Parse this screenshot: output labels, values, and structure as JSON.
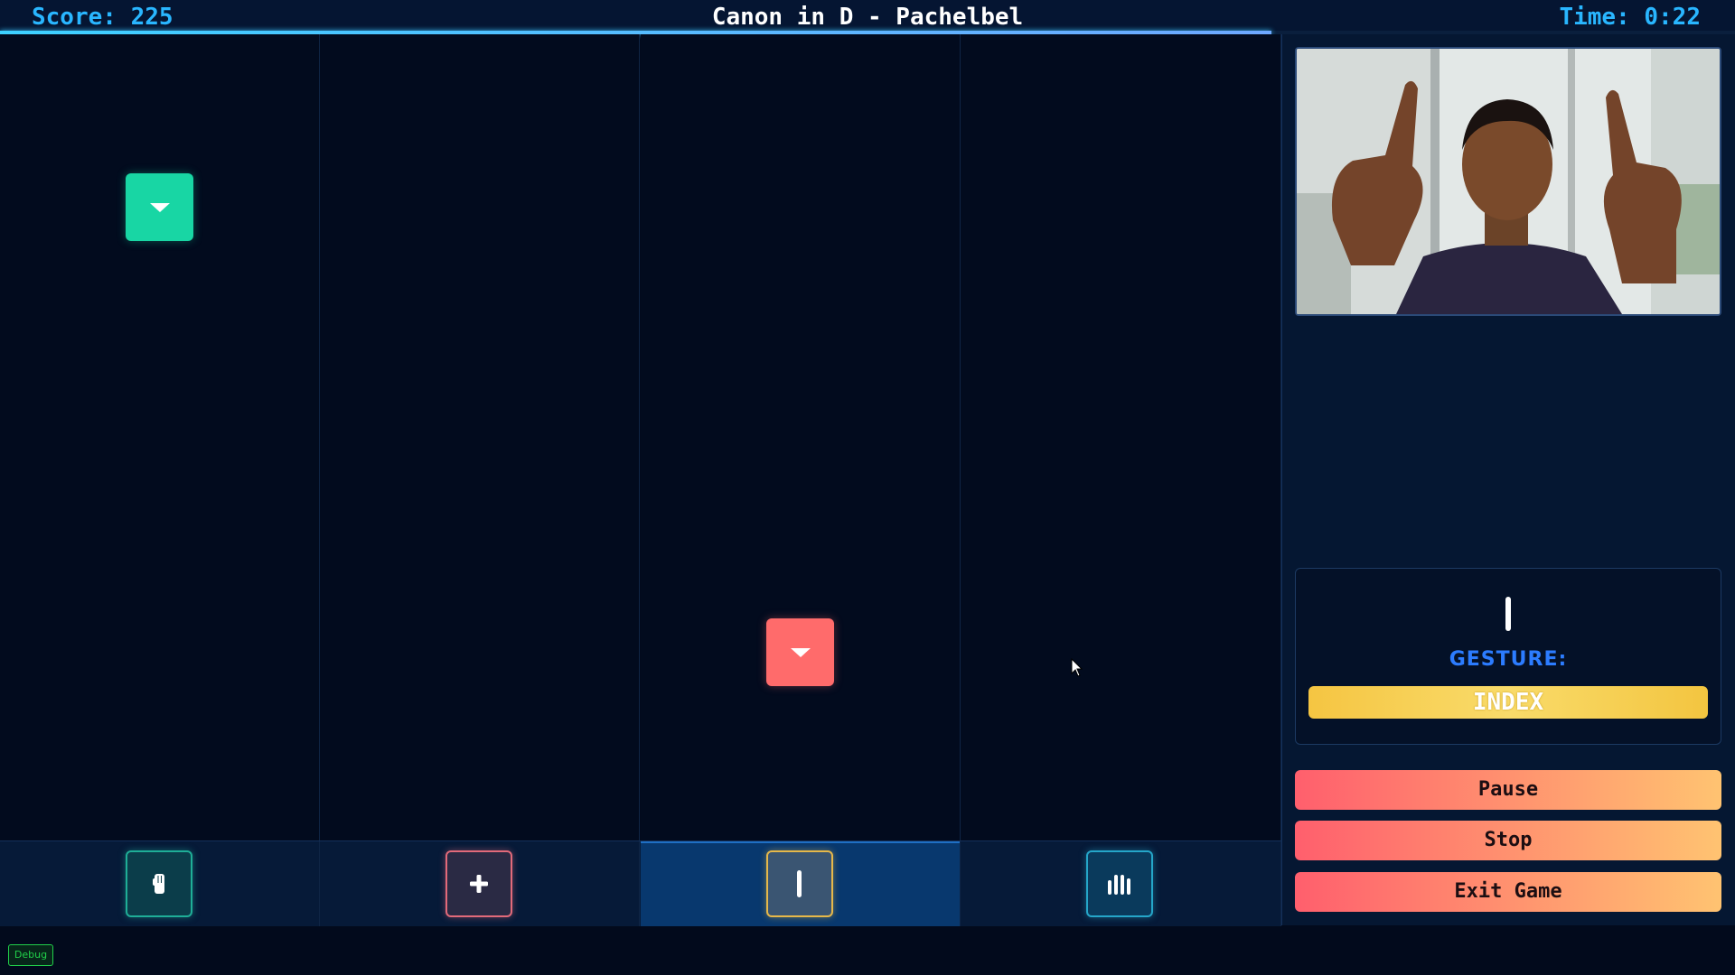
{
  "header": {
    "score_text": "Score: 225",
    "song_title": "Canon in D - Pachelbel",
    "time_text": "Time: 0:22",
    "progress_fraction": 0.733
  },
  "lanes": [
    {
      "name": "lane-1",
      "key_icon": "fist-icon",
      "accent": "#1fae97"
    },
    {
      "name": "lane-2",
      "key_icon": "plus-icon",
      "accent": "#e26a7a"
    },
    {
      "name": "lane-3",
      "key_icon": "index-finger-icon",
      "accent": "#e6b84a",
      "active": true
    },
    {
      "name": "lane-4",
      "key_icon": "four-fingers-icon",
      "accent": "#25a6c9"
    }
  ],
  "notes": [
    {
      "lane": 1,
      "color": "#18d6a4",
      "icon": "arrow-down-icon"
    },
    {
      "lane": 3,
      "color": "#ff6b6b",
      "icon": "arrow-down-icon"
    }
  ],
  "side_panel": {
    "camera_feed": "webcam-preview",
    "gesture_icon": "index-finger-icon",
    "gesture_label": "GESTURE:",
    "gesture_value": "INDEX",
    "buttons": {
      "pause": "Pause",
      "stop": "Stop",
      "exit": "Exit Game"
    }
  },
  "debug_label": "Debug",
  "colors": {
    "accent_blue": "#29b6ff",
    "button_gradient_start": "#ff5f6d",
    "button_gradient_end": "#ffc371",
    "gesture_highlight": "#f5c542"
  }
}
